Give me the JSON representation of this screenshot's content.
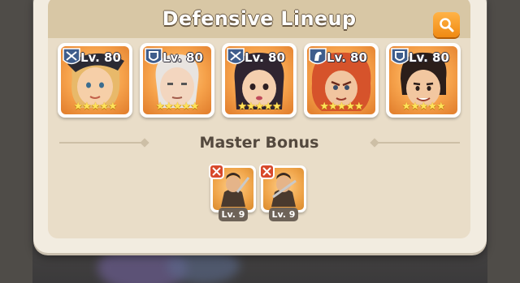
{
  "dialog": {
    "title": "Defensive Lineup",
    "search_icon": "magnifier-icon"
  },
  "heroes": [
    {
      "level": "Lv. 80",
      "class_icon": "crossbow-icon",
      "stars": "★★★★★"
    },
    {
      "level": "Lv. 80",
      "class_icon": "shield-icon",
      "stars": "★★★★★"
    },
    {
      "level": "Lv. 80",
      "class_icon": "crossbow-icon",
      "stars": "★★★★★"
    },
    {
      "level": "Lv. 80",
      "class_icon": "horse-icon",
      "stars": "★★★★★"
    },
    {
      "level": "Lv. 80",
      "class_icon": "shield-icon",
      "stars": "★★★★★"
    }
  ],
  "master_bonus": {
    "title": "Master Bonus",
    "items": [
      {
        "level": "Lv. 9",
        "badge_icon": "crossed-swords-icon"
      },
      {
        "level": "Lv. 9",
        "badge_icon": "crossed-swords-icon"
      }
    ]
  },
  "colors": {
    "accent_orange": "#f08a12",
    "panel": "#e9ddc8",
    "header": "#d8c7a5",
    "star": "#ffe35a"
  }
}
